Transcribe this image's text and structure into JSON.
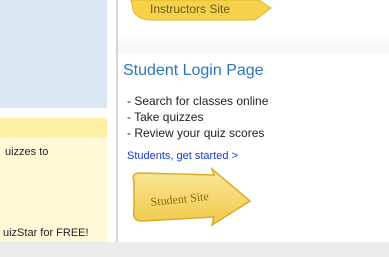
{
  "left": {
    "quiz_text": "uizzes to",
    "signup_text": "uizStar for FREE!"
  },
  "instructors": {
    "banner_label": "Instructors Site"
  },
  "student": {
    "title": "Student Login Page",
    "features": [
      "- Search for classes online",
      "- Take quizzes",
      "- Review your quiz scores"
    ],
    "link_label": "Students, get started >",
    "site_button_label": "Student Site"
  },
  "colors": {
    "title_blue": "#2d76bf",
    "link_blue": "#1a3ad6",
    "arrow_yellow": "#f5d24a",
    "left_panel_blue": "#dbe8f4",
    "left_panel_yellow": "#fff9d8"
  },
  "icons": {
    "student_site": "yellow-arrow-icon",
    "instructors_site": "yellow-arrow-icon"
  }
}
